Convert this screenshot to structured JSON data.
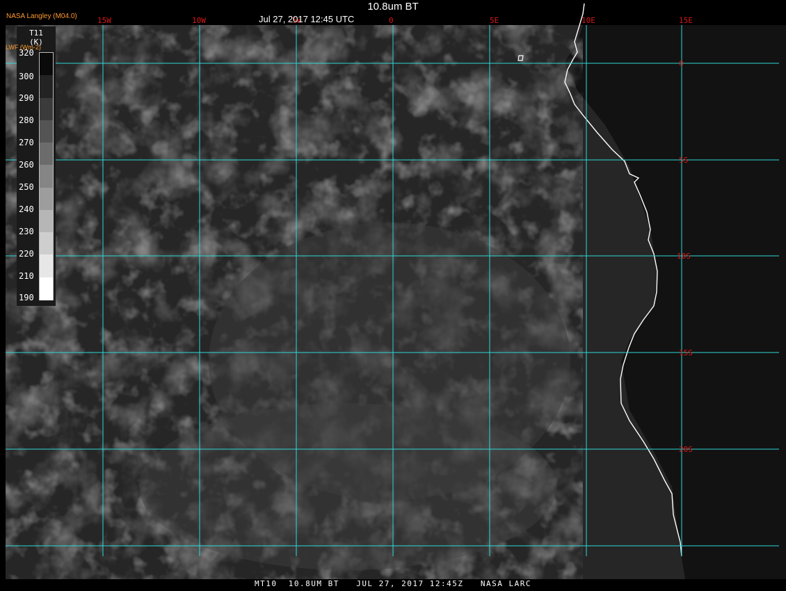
{
  "title": "10.8um BT",
  "subtitle": "Jul 27, 2017 12:45 UTC",
  "credit": "NASA Langley (M04.0)",
  "lwf_label": "LWF (Wm-2)",
  "legend": {
    "title_line1": "T11",
    "title_line2": "(K)",
    "ticks": [
      "320",
      "300",
      "290",
      "280",
      "270",
      "260",
      "250",
      "240",
      "230",
      "220",
      "210",
      "190"
    ]
  },
  "grid": {
    "lon_labels": [
      "15W",
      "10W",
      "5W",
      "0",
      "5E",
      "10E",
      "15E"
    ],
    "lat_labels": [
      "0",
      "5S",
      "10S",
      "15S",
      "20S"
    ]
  },
  "footer": "MT10  10.8UM BT   JUL 27, 2017 12:45Z   NASA LARC",
  "colors": {
    "grid": "#2fd8d8",
    "grid_label": "#d81818",
    "coast": "#ffffff",
    "credit_text": "#ff9a2e"
  }
}
